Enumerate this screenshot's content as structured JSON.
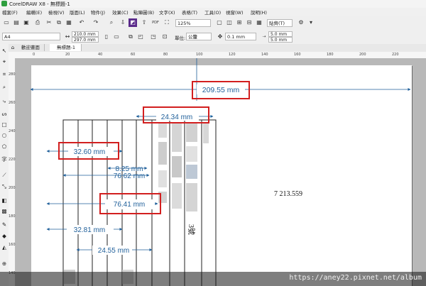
{
  "window": {
    "title": "CorelDRAW X8 - 無標題-1"
  },
  "menu": [
    "檔案(F)",
    "編輯(E)",
    "檢視(V)",
    "版面(L)",
    "物件(J)",
    "效果(C)",
    "點陣圖(B)",
    "文字(X)",
    "表格(T)",
    "工具(O)",
    "視窗(W)",
    "說明(H)"
  ],
  "toolbar": {
    "zoom": "125%",
    "snap_label": "貼齊(T)"
  },
  "property_bar": {
    "page_size": "A4",
    "width": "210.0 mm",
    "height": "297.0 mm",
    "units_label": "單位:",
    "units": "公釐",
    "nudge": "0.1 mm",
    "dup_x": "5.0 mm",
    "dup_y": "5.0 mm"
  },
  "tabs": [
    {
      "label": "歡迎畫面"
    },
    {
      "label": "無標題-1"
    }
  ],
  "ruler": {
    "h_ticks": [
      "0",
      "20",
      "40",
      "60",
      "80",
      "100",
      "120",
      "140",
      "160",
      "180",
      "200",
      "220"
    ],
    "v_ticks": [
      "280",
      "260",
      "240",
      "220",
      "200",
      "180",
      "160",
      "140"
    ]
  },
  "dimensions": [
    {
      "label": "209.55 mm",
      "highlight": true
    },
    {
      "label": "24.34 mm",
      "highlight": true
    },
    {
      "label": "32.60 mm",
      "highlight": true
    },
    {
      "label": "8.25 mm",
      "highlight": false
    },
    {
      "label": "76.62 mm",
      "highlight": false
    },
    {
      "label": "76.41 mm",
      "highlight": true
    },
    {
      "label": "32.81 mm",
      "highlight": false
    },
    {
      "label": "24.55 mm",
      "highlight": false
    }
  ],
  "document": {
    "page_text": "7  213.559",
    "column_text": "3號"
  },
  "watermark": "https://aney22.pixnet.net/album",
  "colors": {
    "dimension": "#1f5f9a",
    "highlight_box": "#d21f1f",
    "canvas": "#b8b8b8"
  },
  "icons": {
    "toolbox": [
      "pick-tool-icon",
      "shape-tool-icon",
      "crop-tool-icon",
      "zoom-tool-icon",
      "freehand-tool-icon",
      "artistic-media-icon",
      "rectangle-tool-icon",
      "ellipse-tool-icon",
      "polygon-tool-icon",
      "text-tool-icon",
      "parallel-dimension-icon",
      "connector-tool-icon",
      "drop-shadow-icon",
      "transparency-icon",
      "eyedropper-icon",
      "fill-tool-icon",
      "smart-fill-icon"
    ]
  }
}
